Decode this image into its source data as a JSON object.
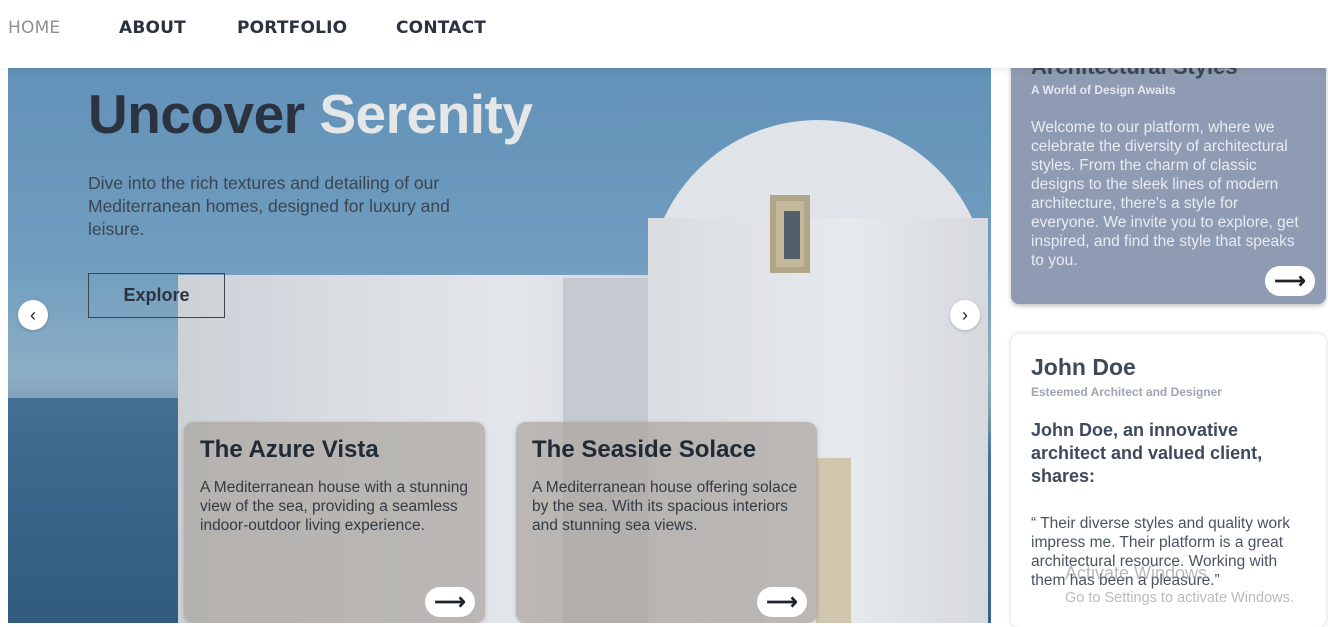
{
  "nav": {
    "items": [
      {
        "label": "HOME",
        "active": true
      },
      {
        "label": "ABOUT",
        "active": false
      },
      {
        "label": "PORTFOLIO",
        "active": false
      },
      {
        "label": "CONTACT",
        "active": false
      }
    ]
  },
  "hero": {
    "title_part1": "Uncover",
    "title_part2": "Serenity",
    "description": "Dive into the rich textures and detailing of our Mediterranean homes, designed for luxury and leisure.",
    "explore_label": "Explore",
    "prev_icon": "‹",
    "next_icon": "›",
    "cards": [
      {
        "title": "The Azure Vista",
        "description": "A Mediterranean house with a stunning view of the sea, providing a seamless indoor-outdoor living experience."
      },
      {
        "title": "The Seaside Solace",
        "description": "A Mediterranean house offering solace by the sea. With its spacious interiors and stunning sea views."
      }
    ]
  },
  "sidebar": {
    "styles_card": {
      "title": "Architectural Styles",
      "subtitle": "A World of Design Awaits",
      "body": "Welcome to our platform, where we celebrate the diversity of architectural styles. From the charm of classic designs to the sleek lines of modern architecture, there's a style for everyone. We invite you to explore, get inspired, and find the style that speaks to you."
    },
    "testimonial_card": {
      "name": "John Doe",
      "role": "Esteemed Architect and Designer",
      "lead": "John Doe, an innovative architect and valued client, shares:",
      "quote": "“ Their diverse styles and quality work impress me. Their platform is a great architectural resource. Working with them has been a pleasure.”"
    }
  },
  "arrow_glyph": "⟶",
  "watermark": {
    "line1": "Activate Windows",
    "line2": "Go to Settings to activate Windows."
  },
  "colors": {
    "nav_text": "#2b3340",
    "nav_active": "#8d9196",
    "styles_card_bg": "#8f9bb3",
    "hero_title_accent": "#e4e6e8"
  }
}
